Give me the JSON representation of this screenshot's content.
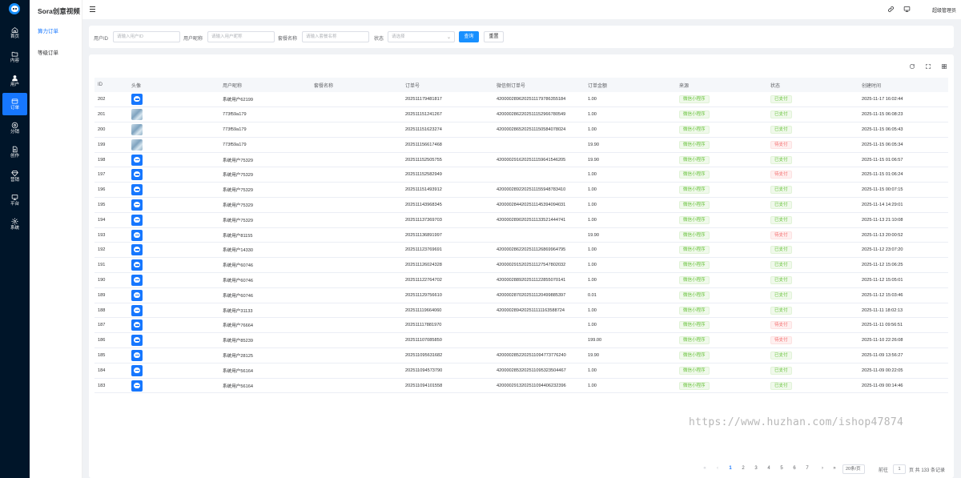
{
  "app": {
    "title": "Sora创意视频"
  },
  "rail": {
    "items": [
      {
        "label": "首页"
      },
      {
        "label": "内容"
      },
      {
        "label": "用户"
      },
      {
        "label": "订单"
      },
      {
        "label": "分销"
      },
      {
        "label": "创作"
      },
      {
        "label": "营销"
      },
      {
        "label": "平台"
      },
      {
        "label": "系统"
      }
    ]
  },
  "submenu": {
    "items": [
      {
        "label": "算力订单"
      },
      {
        "label": "等级订单"
      }
    ]
  },
  "header": {
    "user": "超级管理员"
  },
  "search": {
    "user_id_label": "用户ID",
    "user_id_placeholder": "请输入用户ID",
    "nickname_label": "用户昵称",
    "nickname_placeholder": "请输入用户昵称",
    "package_label": "套餐名称",
    "package_placeholder": "请输入套餐名称",
    "status_label": "状态",
    "status_placeholder": "请选择",
    "query_label": "查询",
    "reset_label": "重置"
  },
  "table": {
    "columns": [
      "ID",
      "头像",
      "用户昵称",
      "套餐名称",
      "订单号",
      "微信侧订单号",
      "订单金额",
      "来源",
      "状态",
      "创建时间"
    ],
    "rows": [
      {
        "id": "202",
        "avatar": "blue",
        "nick": "系统用户62199",
        "pkg": "",
        "order": "202511179481817",
        "wx": "4200002896202511179786355184",
        "amount": "1.00",
        "source": "微信小程序",
        "status": "已支付",
        "time": "2025-11-17 16:02:44"
      },
      {
        "id": "201",
        "avatar": "photo",
        "nick": "773f59a179",
        "pkg": "",
        "order": "202511151241267",
        "wx": "4200002862202511152966780549",
        "amount": "1.00",
        "source": "微信小程序",
        "status": "已支付",
        "time": "2025-11-15 06:08:23"
      },
      {
        "id": "200",
        "avatar": "photo",
        "nick": "773f59a179",
        "pkg": "",
        "order": "202511151623274",
        "wx": "4200002865202511150584078024",
        "amount": "1.00",
        "source": "微信小程序",
        "status": "已支付",
        "time": "2025-11-15 06:05:43"
      },
      {
        "id": "199",
        "avatar": "photo",
        "nick": "773f59a179",
        "pkg": "",
        "order": "202511156617468",
        "wx": "",
        "amount": "19.90",
        "source": "微信小程序",
        "status": "待支付",
        "time": "2025-11-15 06:05:34"
      },
      {
        "id": "198",
        "avatar": "blue",
        "nick": "系统用户75329",
        "pkg": "",
        "order": "202511152505755",
        "wx": "4200002916202511159641546205",
        "amount": "19.90",
        "source": "微信小程序",
        "status": "已支付",
        "time": "2025-11-15 01:06:57"
      },
      {
        "id": "197",
        "avatar": "blue",
        "nick": "系统用户75329",
        "pkg": "",
        "order": "202511152582949",
        "wx": "",
        "amount": "1.00",
        "source": "微信小程序",
        "status": "待支付",
        "time": "2025-11-15 01:06:24"
      },
      {
        "id": "196",
        "avatar": "blue",
        "nick": "系统用户75329",
        "pkg": "",
        "order": "202511151493912",
        "wx": "4200002892202511155948783410",
        "amount": "1.00",
        "source": "微信小程序",
        "status": "已支付",
        "time": "2025-11-15 00:07:15"
      },
      {
        "id": "195",
        "avatar": "blue",
        "nick": "系统用户75329",
        "pkg": "",
        "order": "202511143968345",
        "wx": "4200002844202511145394094031",
        "amount": "1.00",
        "source": "微信小程序",
        "status": "已支付",
        "time": "2025-11-14 14:29:01"
      },
      {
        "id": "194",
        "avatar": "blue",
        "nick": "系统用户75329",
        "pkg": "",
        "order": "202511137369703",
        "wx": "4200002890202511133521444741",
        "amount": "1.00",
        "source": "微信小程序",
        "status": "已支付",
        "time": "2025-11-13 21:10:08"
      },
      {
        "id": "193",
        "avatar": "blue",
        "nick": "系统用户81155",
        "pkg": "",
        "order": "202511136891997",
        "wx": "",
        "amount": "19.90",
        "source": "微信小程序",
        "status": "待支付",
        "time": "2025-11-13 20:00:52"
      },
      {
        "id": "192",
        "avatar": "blue",
        "nick": "系统用户14330",
        "pkg": "",
        "order": "202511123769691",
        "wx": "4200002862202511126869964795",
        "amount": "1.00",
        "source": "微信小程序",
        "status": "已支付",
        "time": "2025-11-12 23:07:20"
      },
      {
        "id": "191",
        "avatar": "blue",
        "nick": "系统用户60746",
        "pkg": "",
        "order": "202511126024328",
        "wx": "4200002915202511127547802032",
        "amount": "1.00",
        "source": "微信小程序",
        "status": "已支付",
        "time": "2025-11-12 15:06:25"
      },
      {
        "id": "190",
        "avatar": "blue",
        "nick": "系统用户60746",
        "pkg": "",
        "order": "202511122764702",
        "wx": "4200002889202511122855070141",
        "amount": "1.00",
        "source": "微信小程序",
        "status": "已支付",
        "time": "2025-11-12 15:05:01"
      },
      {
        "id": "189",
        "avatar": "blue",
        "nick": "系统用户60746",
        "pkg": "",
        "order": "202511129756610",
        "wx": "4200002870202511120499885397",
        "amount": "0.01",
        "source": "微信小程序",
        "status": "已支付",
        "time": "2025-11-12 15:03:46"
      },
      {
        "id": "188",
        "avatar": "blue",
        "nick": "系统用户31133",
        "pkg": "",
        "order": "202511119664060",
        "wx": "4200002894202511111163588724",
        "amount": "1.00",
        "source": "微信小程序",
        "status": "已支付",
        "time": "2025-11-11 18:02:13"
      },
      {
        "id": "187",
        "avatar": "blue",
        "nick": "系统用户76664",
        "pkg": "",
        "order": "202511117881970",
        "wx": "",
        "amount": "1.00",
        "source": "微信小程序",
        "status": "待支付",
        "time": "2025-11-11 09:56:51"
      },
      {
        "id": "186",
        "avatar": "blue",
        "nick": "系统用户85239",
        "pkg": "",
        "order": "202511107085850",
        "wx": "",
        "amount": "199.00",
        "source": "微信小程序",
        "status": "待支付",
        "time": "2025-11-10 22:26:08"
      },
      {
        "id": "185",
        "avatar": "blue",
        "nick": "系统用户28125",
        "pkg": "",
        "order": "202511095631682",
        "wx": "4200002852202511094773776240",
        "amount": "19.90",
        "source": "微信小程序",
        "status": "已支付",
        "time": "2025-11-09 13:56:27"
      },
      {
        "id": "184",
        "avatar": "blue",
        "nick": "系统用户56164",
        "pkg": "",
        "order": "202511094573790",
        "wx": "4200002853202511095323504467",
        "amount": "1.00",
        "source": "微信小程序",
        "status": "已支付",
        "time": "2025-11-09 00:22:05"
      },
      {
        "id": "183",
        "avatar": "blue",
        "nick": "系统用户56164",
        "pkg": "",
        "order": "202511094101558",
        "wx": "4200002913202511094406232396",
        "amount": "1.00",
        "source": "微信小程序",
        "status": "已支付",
        "time": "2025-11-09 00:14:46"
      }
    ]
  },
  "colors": {
    "accent": "#1677ff",
    "paid": "#67c23a",
    "unpaid": "#f56c6c",
    "rail_bg": "#001529"
  },
  "icons": [
    "home-icon",
    "folder-icon",
    "user-icon",
    "order-icon",
    "share-icon",
    "document-icon",
    "diamond-icon",
    "monitor-icon",
    "gear-icon",
    "link-icon",
    "screen-icon",
    "refresh-icon",
    "fullscreen-icon",
    "columns-icon"
  ],
  "pagination": {
    "pages": [
      "1",
      "2",
      "3",
      "4",
      "5",
      "6",
      "7"
    ],
    "current": "1",
    "page_size": "20条/页",
    "goto_label": "前往",
    "goto_value": "1",
    "total_text": "页 共 133 条记录"
  },
  "watermark": "https://www.huzhan.com/ishop47874"
}
